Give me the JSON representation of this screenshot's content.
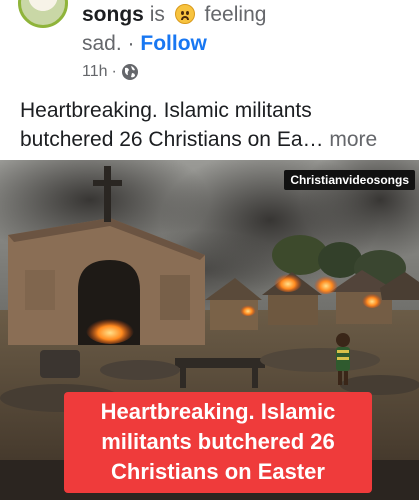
{
  "header": {
    "author": "songs",
    "feeling_prefix": "is",
    "feeling_word": "feeling",
    "feeling_value": "sad.",
    "separator": "·",
    "follow_label": "Follow",
    "time": "11h",
    "time_separator": "·",
    "visibility_icon": "globe-icon"
  },
  "caption": {
    "text": "Heartbreaking. Islamic militants butchered 26 Christians on Ea…",
    "more_label": "more"
  },
  "media": {
    "watermark": "Christianvideosongs",
    "headline_lines": [
      "Heartbreaking. Islamic",
      "militants butchered 26",
      "Christians on Easter"
    ],
    "headline_bg": "#ef3b3b"
  },
  "colors": {
    "link": "#1877f2",
    "secondary_text": "#65676b"
  }
}
